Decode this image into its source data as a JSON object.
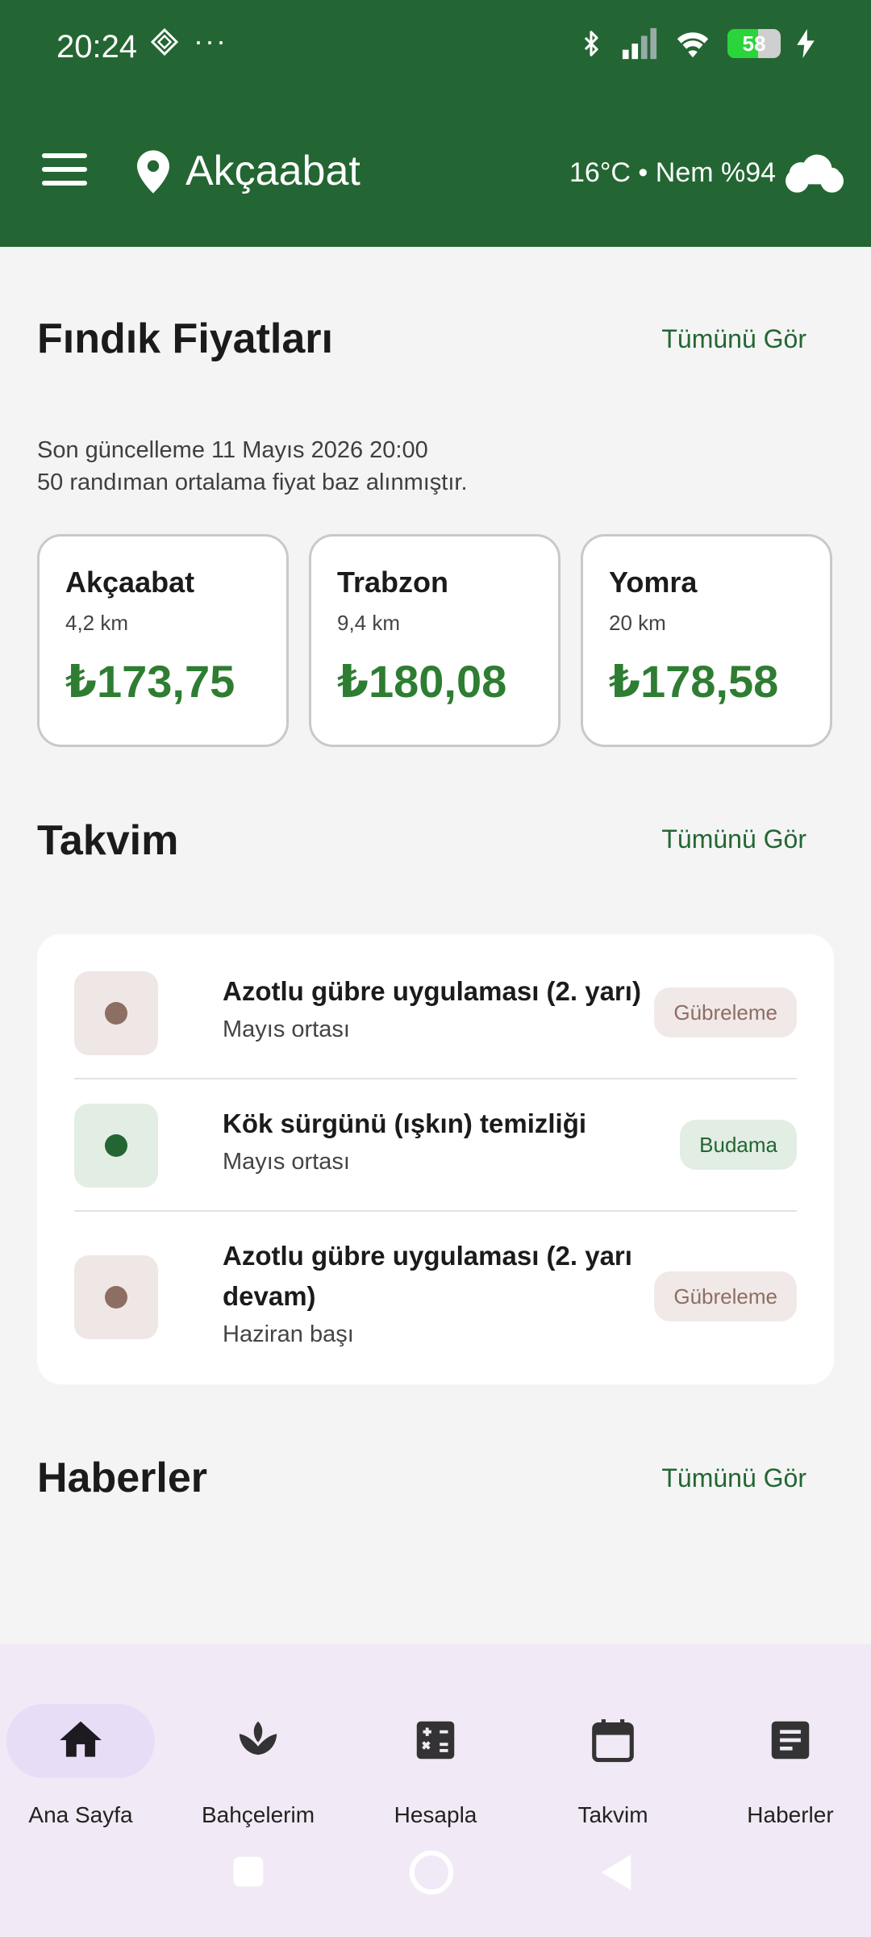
{
  "status": {
    "time": "20:24",
    "battery": "58"
  },
  "header": {
    "city": "Akçaabat",
    "weather": "16°C • Nem %94"
  },
  "prices": {
    "title": "Fındık Fiyatları",
    "see_all": "Tümünü Gör",
    "updated": "Son güncelleme 11 Mayıs 2026 20:00",
    "note": "50 randıman ortalama fiyat baz alınmıştır.",
    "cards": [
      {
        "name": "Akçaabat",
        "distance": "4,2 km",
        "price": "₺173,75"
      },
      {
        "name": "Trabzon",
        "distance": "9,4 km",
        "price": "₺180,08"
      },
      {
        "name": "Yomra",
        "distance": "20 km",
        "price": "₺178,58"
      }
    ]
  },
  "calendar": {
    "title": "Takvim",
    "see_all": "Tümünü Gör",
    "items": [
      {
        "title": "Azotlu gübre uygulaması (2. yarı)",
        "when": "Mayıs ortası",
        "tag": "Gübreleme",
        "color": "#8d6e63"
      },
      {
        "title": "Kök sürgünü (ışkın) temizliği",
        "when": "Mayıs ortası",
        "tag": "Budama",
        "color": "#236633"
      },
      {
        "title": "Azotlu gübre uygulaması (2. yarı devam)",
        "when": "Haziran başı",
        "tag": "Gübreleme",
        "color": "#8d6e63"
      }
    ]
  },
  "news": {
    "title": "Haberler",
    "see_all": "Tümünü Gör"
  },
  "nav": {
    "items": [
      {
        "label": "Ana Sayfa",
        "icon": "home-icon",
        "active": true
      },
      {
        "label": "Bahçelerim",
        "icon": "plant-icon"
      },
      {
        "label": "Hesapla",
        "icon": "calculator-icon"
      },
      {
        "label": "Takvim",
        "icon": "calendar-icon"
      },
      {
        "label": "Haberler",
        "icon": "article-icon"
      }
    ]
  },
  "colors": {
    "primary": "#236633",
    "accent_green": "#2e7d32",
    "brown": "#8d6e63"
  }
}
